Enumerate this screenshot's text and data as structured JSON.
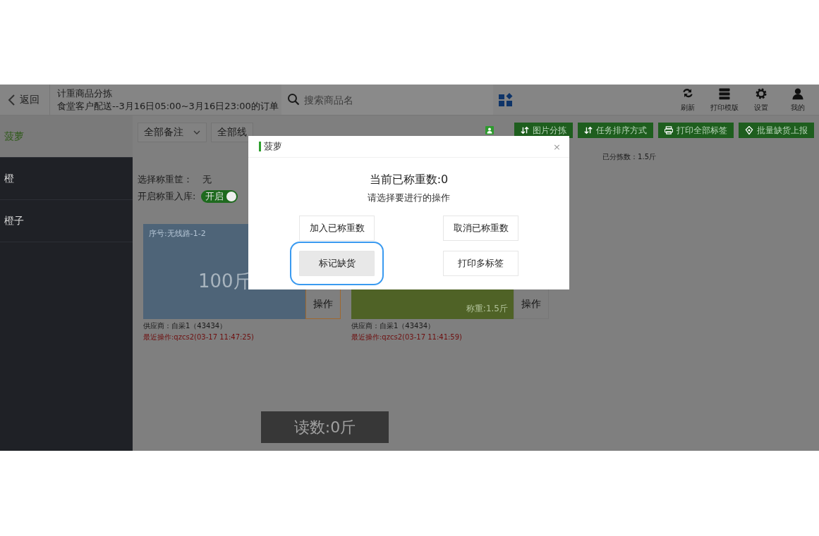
{
  "top_bar": {
    "back_label": "返回",
    "title": "计重商品分拣",
    "subtitle": "食堂客户配送--3月16日05:00~3月16日23:00的订单",
    "search_placeholder": "搜索商品名",
    "actions": [
      {
        "kind": "refresh",
        "label": "刷新"
      },
      {
        "kind": "template",
        "label": "打印模版"
      },
      {
        "kind": "settings",
        "label": "设置"
      },
      {
        "kind": "user",
        "label": "我的"
      }
    ]
  },
  "sidebar": {
    "items": [
      {
        "label": "菠萝",
        "selected": true
      },
      {
        "label": "橙",
        "selected": false
      },
      {
        "label": "橙子",
        "selected": false
      }
    ]
  },
  "filters": [
    {
      "label": "全部备注",
      "caret": true
    },
    {
      "label": "全部线",
      "caret": false
    }
  ],
  "toolbar": [
    {
      "kind": "sort",
      "label": "图片分拣"
    },
    {
      "kind": "sort",
      "label": "任务排序方式"
    },
    {
      "kind": "print",
      "label": "打印全部标签"
    },
    {
      "kind": "report",
      "label": "批量缺货上报"
    }
  ],
  "sorted_count": "已分拣数：1.5斤",
  "basket": {
    "label": "选择称重筐：",
    "value": "无"
  },
  "storage": {
    "label": "开启称重入库:",
    "toggle_text": "开启",
    "on": true
  },
  "cards": [
    {
      "color": "#4e6478",
      "serial": "序号:无线路-1-2",
      "weight": "100斤",
      "action": "操作",
      "action_selected": true,
      "supplier": "供应商：自采1（43434）",
      "last_op": "最近操作:qzcs2(03-17 11:47:25)"
    },
    {
      "color": "#4f6226",
      "weighed": "称重:1.5斤",
      "action": "操作",
      "action_selected": false,
      "supplier": "供应商：自采1（43434）",
      "last_op": "最近操作:qzcs2(03-17 11:41:59)"
    }
  ],
  "reading": "读数:0斤",
  "modal": {
    "title": "菠萝",
    "close": "×",
    "heading": "当前已称重数:0",
    "prompt": "请选择要进行的操作",
    "buttons": [
      {
        "label": "加入已称重数",
        "selected": false
      },
      {
        "label": "取消已称重数",
        "selected": false
      },
      {
        "label": "标记缺货",
        "selected": true
      },
      {
        "label": "打印多标签",
        "selected": false
      }
    ]
  }
}
